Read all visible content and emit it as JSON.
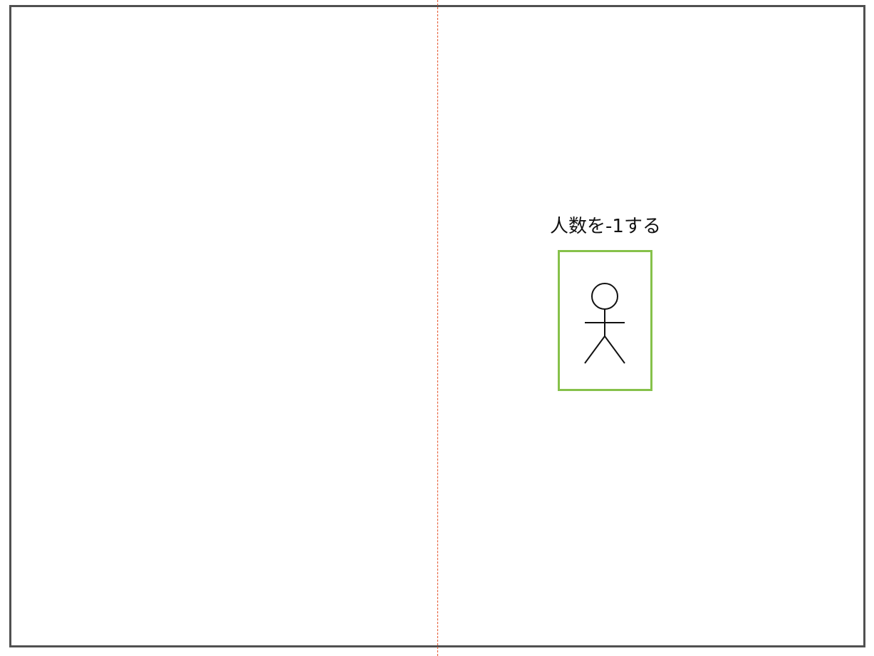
{
  "caption": {
    "text": "人数を-1する"
  },
  "actor": {
    "icon": "stick-figure-person-icon"
  },
  "colors": {
    "frame_border": "#505050",
    "divider": "#e4532a",
    "actor_box_border": "#86c14a",
    "text": "#111111"
  }
}
